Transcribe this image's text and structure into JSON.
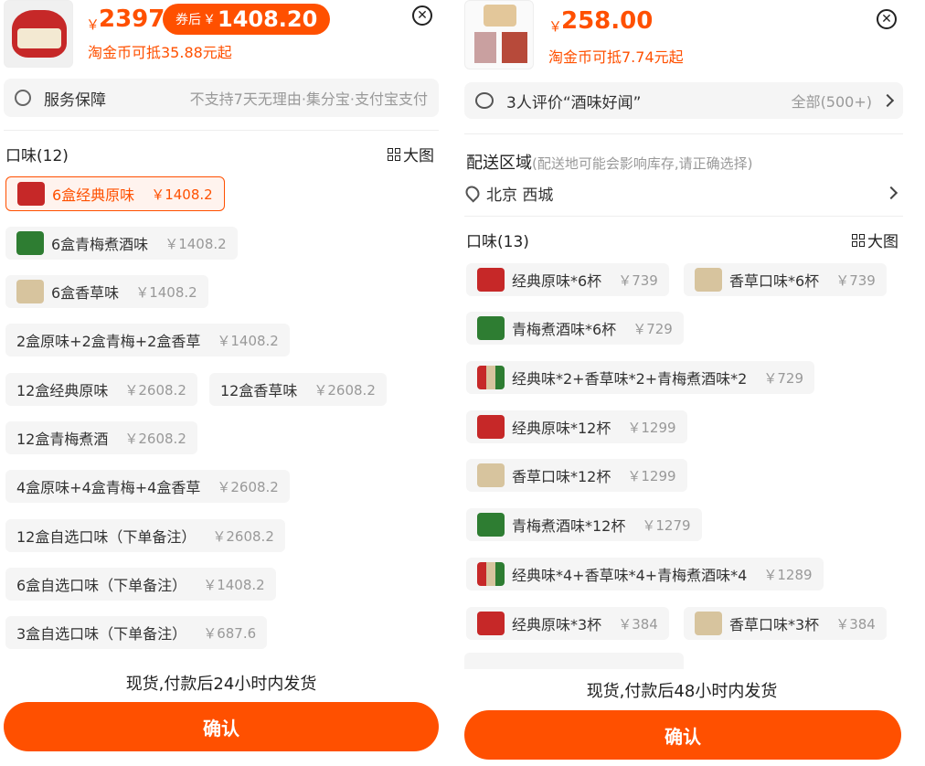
{
  "left": {
    "price": "2397",
    "coupon_label": "券后",
    "coupon_price": "1408.20",
    "coin_text": "淘金币可抵35.88元起",
    "service_label": "服务保障",
    "service_value": "不支持7天无理由·集分宝·支付宝支付",
    "flavor_title": "口味(12)",
    "big_view": "大图",
    "options": [
      {
        "name": "6盒经典原味",
        "price": "￥1408.2"
      },
      {
        "name": "6盒青梅煮酒味",
        "price": "￥1408.2"
      },
      {
        "name": "6盒香草味",
        "price": "￥1408.2"
      },
      {
        "name": "2盒原味+2盒青梅+2盒香草",
        "price": "￥1408.2"
      },
      {
        "name": "12盒经典原味",
        "price": "￥2608.2"
      },
      {
        "name": "12盒香草味",
        "price": "￥2608.2"
      },
      {
        "name": "12盒青梅煮酒",
        "price": "￥2608.2"
      },
      {
        "name": "4盒原味+4盒青梅+4盒香草",
        "price": "￥2608.2"
      },
      {
        "name": "12盒自选口味（下单备注）",
        "price": "￥2608.2"
      },
      {
        "name": "6盒自选口味（下单备注）",
        "price": "￥1408.2"
      },
      {
        "name": "3盒自选口味（下单备注）",
        "price": "￥687.6"
      }
    ],
    "shipping": "现货,付款后24小时内发货",
    "confirm": "确认"
  },
  "right": {
    "price": "258.00",
    "coin_text": "淘金币可抵7.74元起",
    "review_text": "3人评价“酒味好闻”",
    "review_all": "全部(500+)",
    "delivery_title": "配送区域",
    "delivery_note": "(配送地可能会影响库存,请正确选择)",
    "delivery_location": "北京 西城",
    "flavor_title": "口味(13)",
    "big_view": "大图",
    "options": [
      {
        "name": "经典原味*6杯",
        "price": "￥739"
      },
      {
        "name": "香草口味*6杯",
        "price": "￥739"
      },
      {
        "name": "青梅煮酒味*6杯",
        "price": "￥729"
      },
      {
        "name": "经典味*2+香草味*2+青梅煮酒味*2",
        "price": "￥729"
      },
      {
        "name": "经典原味*12杯",
        "price": "￥1299"
      },
      {
        "name": "香草口味*12杯",
        "price": "￥1299"
      },
      {
        "name": "青梅煮酒味*12杯",
        "price": "￥1279"
      },
      {
        "name": "经典味*4+香草味*4+青梅煮酒味*4",
        "price": "￥1289"
      },
      {
        "name": "经典原味*3杯",
        "price": "￥384"
      },
      {
        "name": "香草口味*3杯",
        "price": "￥384"
      }
    ],
    "shipping": "现货,付款后48小时内发货",
    "confirm": "确认"
  },
  "yen": "￥",
  "colors": {
    "accent": "#ff5000",
    "chip_bg": "#f5f5f5",
    "muted": "#999999"
  }
}
